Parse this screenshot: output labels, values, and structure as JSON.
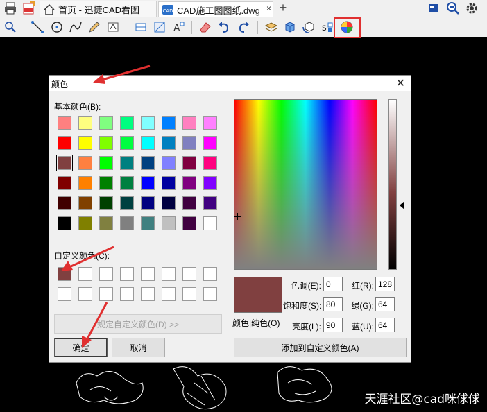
{
  "tabs": {
    "home_label": "首页 - 迅捷CAD看图",
    "file_label": "CAD施工图图纸.dwg",
    "close_glyph": "×",
    "add_glyph": "+"
  },
  "dialog": {
    "title": "颜色",
    "close_glyph": "✕",
    "basic_colors_label": "基本颜色(B):",
    "custom_colors_label": "自定义颜色(C):",
    "define_custom_button": "规定自定义颜色(D) >>",
    "ok_button": "确定",
    "cancel_button": "取消",
    "add_custom_button": "添加到自定义颜色(A)",
    "preview_label": "颜色|纯色(O)",
    "hue_label": "色调(E):",
    "hue": "0",
    "sat_label": "饱和度(S):",
    "sat": "80",
    "lum_label": "亮度(L):",
    "lum": "90",
    "red_label": "红(R):",
    "red": "128",
    "green_label": "绿(G):",
    "green": "64",
    "blue_label": "蓝(U):",
    "blue": "64",
    "selected_color": "#804040",
    "basic_colors": [
      [
        "#ff8080",
        "#ffff80",
        "#80ff80",
        "#00ff80",
        "#80ffff",
        "#0080ff",
        "#ff80c0",
        "#ff80ff"
      ],
      [
        "#ff0000",
        "#ffff00",
        "#80ff00",
        "#00ff40",
        "#00ffff",
        "#0080c0",
        "#8080c0",
        "#ff00ff"
      ],
      [
        "#804040",
        "#ff8040",
        "#00ff00",
        "#008080",
        "#004080",
        "#8080ff",
        "#800040",
        "#ff0080"
      ],
      [
        "#800000",
        "#ff8000",
        "#008000",
        "#008040",
        "#0000ff",
        "#0000a0",
        "#800080",
        "#8000ff"
      ],
      [
        "#400000",
        "#804000",
        "#004000",
        "#004040",
        "#000080",
        "#000040",
        "#400040",
        "#400080"
      ],
      [
        "#000000",
        "#808000",
        "#808040",
        "#808080",
        "#408080",
        "#c0c0c0",
        "#400040",
        "#ffffff"
      ]
    ],
    "custom_colors": [
      [
        "#804040",
        "#ffffff",
        "#ffffff",
        "#ffffff",
        "#ffffff",
        "#ffffff",
        "#ffffff",
        "#ffffff"
      ],
      [
        "#ffffff",
        "#ffffff",
        "#ffffff",
        "#ffffff",
        "#ffffff",
        "#ffffff",
        "#ffffff",
        "#ffffff"
      ]
    ]
  },
  "watermark": "天涯社区@cad咪俅俅",
  "accent_red": "#e03030"
}
